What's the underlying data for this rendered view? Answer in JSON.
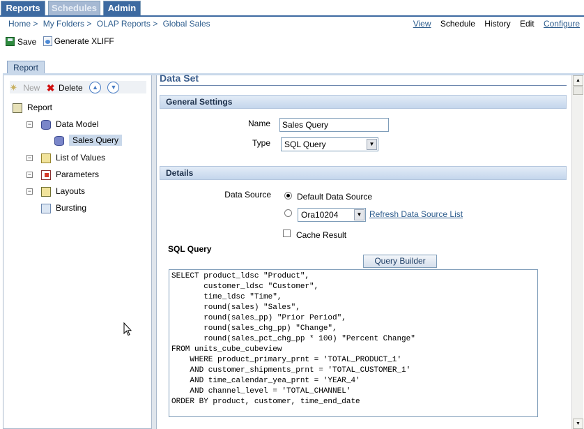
{
  "top_tabs": {
    "reports": "Reports",
    "schedules": "Schedules",
    "admin": "Admin"
  },
  "breadcrumb": [
    "Home >",
    "My Folders >",
    "OLAP Reports >",
    "Global Sales"
  ],
  "nav_links": {
    "view": "View",
    "schedule": "Schedule",
    "history": "History",
    "edit": "Edit",
    "configure": "Configure"
  },
  "toolbar": {
    "save": "Save",
    "generate_xliff": "Generate XLIFF"
  },
  "report_tab": "Report",
  "left_toolbar": {
    "new": "New",
    "delete": "Delete",
    "up_icon": "arrow-up-icon",
    "down_icon": "arrow-down-icon"
  },
  "tree": {
    "report": "Report",
    "data_model": "Data Model",
    "sales_query": "Sales Query",
    "list_of_values": "List of Values",
    "parameters": "Parameters",
    "layouts": "Layouts",
    "bursting": "Bursting"
  },
  "data_set": {
    "title": "Data Set",
    "general_settings": "General Settings",
    "name_label": "Name",
    "name_value": "Sales Query",
    "type_label": "Type",
    "type_value": "SQL Query",
    "details": "Details",
    "data_source_label": "Data Source",
    "default_data_source": "Default Data Source",
    "data_source_option": "Ora10204",
    "refresh_link": "Refresh Data Source List",
    "cache_result": "Cache Result",
    "sql_query_label": "SQL Query",
    "query_builder": "Query Builder",
    "sql_text": "SELECT product_ldsc \"Product\",\n       customer_ldsc \"Customer\",\n       time_ldsc \"Time\",\n       round(sales) \"Sales\",\n       round(sales_pp) \"Prior Period\",\n       round(sales_chg_pp) \"Change\",\n       round(sales_pct_chg_pp * 100) \"Percent Change\"\nFROM units_cube_cubeview\n    WHERE product_primary_prnt = 'TOTAL_PRODUCT_1'\n    AND customer_shipments_prnt = 'TOTAL_CUSTOMER_1'\n    AND time_calendar_yea_prnt = 'YEAR_4'\n    AND channel_level = 'TOTAL_CHANNEL'\nORDER BY product, customer, time_end_date"
  },
  "colors": {
    "tab_blue": "#3d6aa1",
    "link_blue": "#2f5e8e",
    "section_bar": "#c4d6ec"
  }
}
